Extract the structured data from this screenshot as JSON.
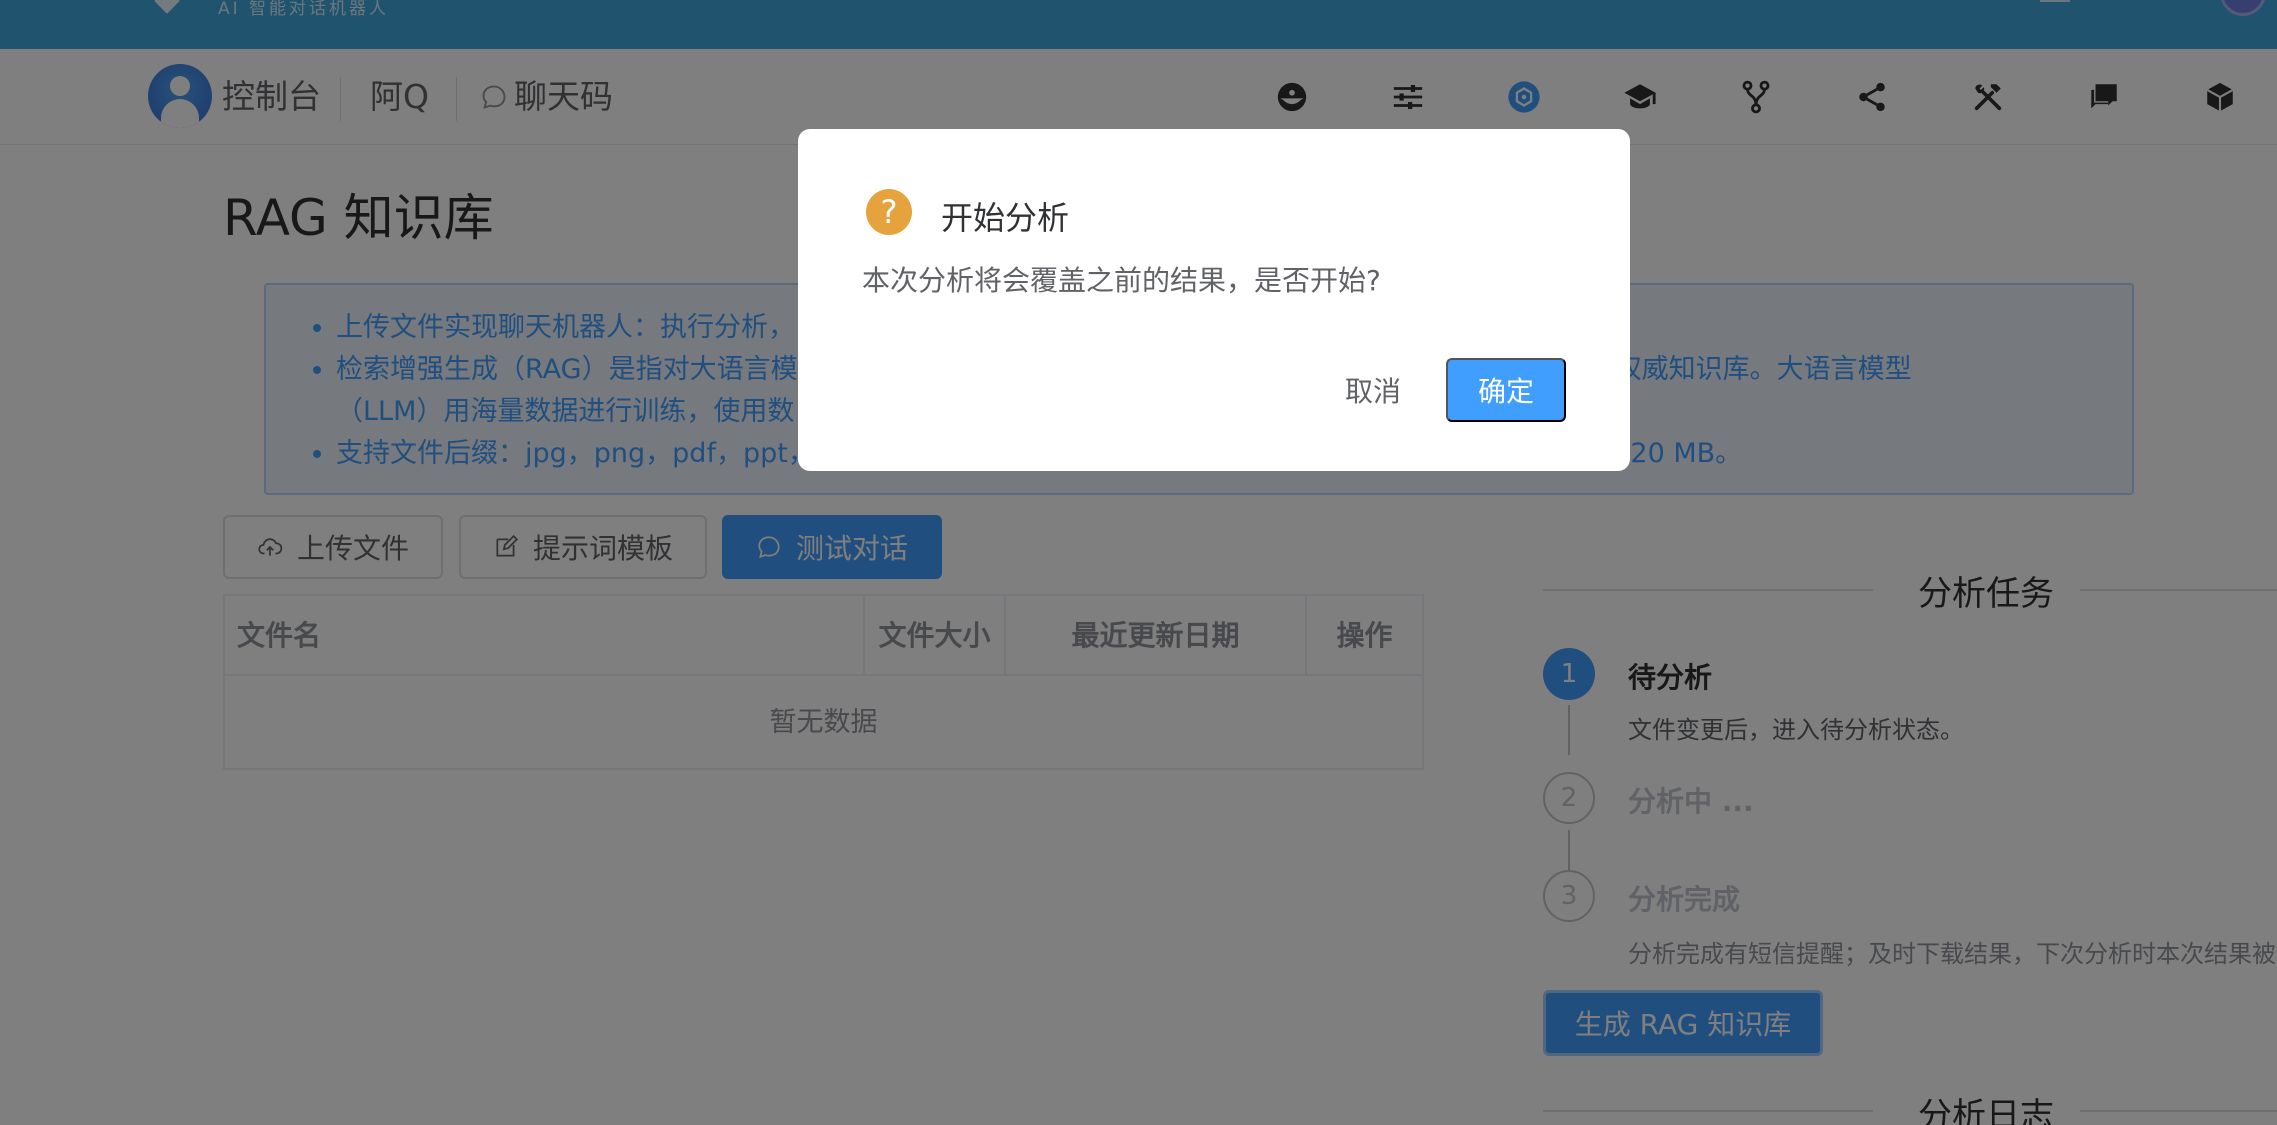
{
  "topbar": {
    "brand_subtitle": "AI 智能对话机器人"
  },
  "nav": {
    "items": [
      {
        "label": "控制台"
      },
      {
        "label": "阿Q"
      },
      {
        "label": "聊天码"
      }
    ],
    "icons": [
      "dashboard-icon",
      "sliders-icon",
      "knowledge-base-icon",
      "graduation-cap-icon",
      "fork-icon",
      "share-icon",
      "tools-icon",
      "chat-bubbles-icon",
      "cube-icon"
    ]
  },
  "page": {
    "title": "RAG 知识库",
    "notes": [
      "上传文件实现聊天机器人：执行分析，",
      "检索增强生成（RAG）是指对大语言模",
      "的权威知识库。大语言模型",
      "（LLM）用海量数据进行训练，使用数",
      "支持文件后缀：jpg，png，pdf，ppt，",
      "于 20 MB。"
    ]
  },
  "toolbar": {
    "upload": "上传文件",
    "prompt_template": "提示词模板",
    "test_chat": "测试对话"
  },
  "table": {
    "columns": [
      "文件名",
      "文件大小",
      "最近更新日期",
      "操作"
    ],
    "empty_text": "暂无数据"
  },
  "tasks": {
    "title": "分析任务",
    "steps": [
      {
        "num": "1",
        "title": "待分析",
        "desc": "文件变更后，进入待分析状态。"
      },
      {
        "num": "2",
        "title": "分析中 ...",
        "desc": ""
      },
      {
        "num": "3",
        "title": "分析完成",
        "desc": "分析完成有短信提醒；及时下载结果，下次分析时本次结果被"
      }
    ],
    "generate_button": "生成 RAG 知识库",
    "log_title": "分析日志"
  },
  "dialog": {
    "icon": "?",
    "title": "开始分析",
    "message": "本次分析将会覆盖之前的结果，是否开始?",
    "cancel": "取消",
    "confirm": "确定"
  },
  "colors": {
    "primary": "#409eff",
    "warning": "#e6a23c",
    "banner": "#3fa6dd"
  }
}
